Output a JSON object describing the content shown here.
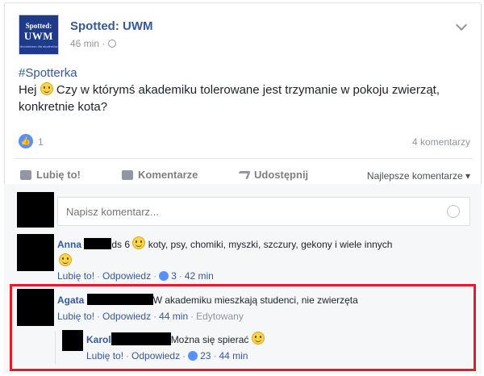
{
  "page": {
    "logo_top": "Spotted:",
    "logo_mid": "UWM",
    "logo_sub": "Anonimowo dla studentów",
    "name": "Spotted: UWM",
    "time": "46 min ·"
  },
  "post": {
    "hashtag": "#Spotterka",
    "text_before_emoji": "Hej ",
    "text_after_emoji": " Czy w którymś akademiku tolerowane jest trzymanie w pokoju zwierząt, konkretnie kota?"
  },
  "stats": {
    "likes": "1",
    "comments": "4 komentarzy"
  },
  "actions": {
    "like": "Lubię to!",
    "comment": "Komentarze",
    "share": "Udostępnij",
    "sort": "Najlepsze komentarze ▾"
  },
  "write": {
    "placeholder": "Napisz komentarz..."
  },
  "comments": [
    {
      "author": "Anna",
      "text_a": "ds 6",
      "text_b": "koty, psy, chomiki, myszki, szczury, gekony i wiele innych",
      "like": "Lubię to!",
      "reply": "Odpowiedz",
      "reactions": "3",
      "time": "42 min"
    },
    {
      "author": "Agata",
      "text": "W akademiku mieszkają studenci, nie zwierzęta",
      "like": "Lubię to!",
      "reply": "Odpowiedz",
      "time": "44 min",
      "edited": "Edytowany"
    },
    {
      "author": "Karol",
      "text": "Można się spierać",
      "like": "Lubię to!",
      "reply": "Odpowiedz",
      "reactions": "23",
      "time": "44 min"
    }
  ],
  "colors": {
    "link": "#365899",
    "highlight": "#e11d2a",
    "like_blue": "#5890ff"
  }
}
